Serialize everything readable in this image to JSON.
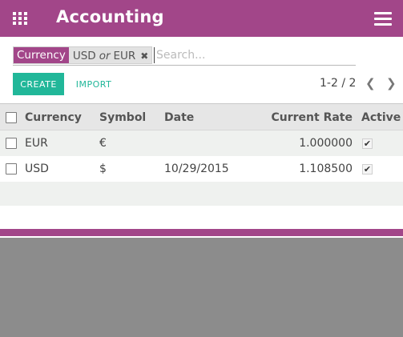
{
  "app": {
    "title": "Accounting"
  },
  "search": {
    "facet_category": "Currency",
    "facet_value_1": "USD",
    "facet_or": "or",
    "facet_value_2": "EUR",
    "placeholder": "Search..."
  },
  "toolbar": {
    "create_label": "CREATE",
    "import_label": "IMPORT"
  },
  "pager": {
    "value": "1-2 / 2"
  },
  "table": {
    "columns": [
      "Currency",
      "Symbol",
      "Date",
      "Current Rate",
      "Active"
    ],
    "rows": [
      {
        "currency": "EUR",
        "symbol": "€",
        "date": "",
        "rate": "1.000000",
        "active": true
      },
      {
        "currency": "USD",
        "symbol": "$",
        "date": "10/29/2015",
        "rate": "1.108500",
        "active": true
      }
    ]
  },
  "colors": {
    "brand": "#a24689",
    "accent": "#21b799"
  },
  "icons": {
    "apps": "apps-grid-icon",
    "menu": "hamburger-menu-icon",
    "remove": "close-icon",
    "prev": "chevron-left-icon",
    "next": "chevron-right-icon",
    "check": "check-icon"
  }
}
